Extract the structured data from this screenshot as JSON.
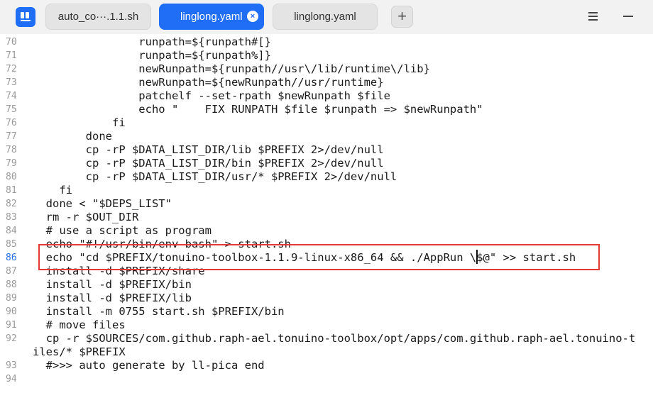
{
  "window": {
    "tabs": [
      {
        "label": "auto_co···.1.1.sh",
        "active": false
      },
      {
        "label": "linglong.yaml",
        "active": true
      },
      {
        "label": "linglong.yaml",
        "active": false
      }
    ],
    "add_tab_label": "+",
    "close_label": "×"
  },
  "editor": {
    "lines": [
      {
        "num": "70",
        "text": "                runpath=${runpath#[}"
      },
      {
        "num": "71",
        "text": "                runpath=${runpath%]}"
      },
      {
        "num": "72",
        "text": "                newRunpath=${runpath//usr\\/lib/runtime\\/lib}"
      },
      {
        "num": "73",
        "text": "                newRunpath=${newRunpath//usr/runtime}"
      },
      {
        "num": "74",
        "text": "                patchelf --set-rpath $newRunpath $file"
      },
      {
        "num": "75",
        "text": "                echo \"    FIX RUNPATH $file $runpath => $newRunpath\""
      },
      {
        "num": "76",
        "text": "            fi"
      },
      {
        "num": "77",
        "text": "        done"
      },
      {
        "num": "78",
        "text": "        cp -rP $DATA_LIST_DIR/lib $PREFIX 2>/dev/null"
      },
      {
        "num": "79",
        "text": "        cp -rP $DATA_LIST_DIR/bin $PREFIX 2>/dev/null"
      },
      {
        "num": "80",
        "text": "        cp -rP $DATA_LIST_DIR/usr/* $PREFIX 2>/dev/null"
      },
      {
        "num": "81",
        "text": "    fi"
      },
      {
        "num": "82",
        "text": "  done < \"$DEPS_LIST\""
      },
      {
        "num": "83",
        "text": "  rm -r $OUT_DIR"
      },
      {
        "num": "84",
        "text": "  # use a script as program"
      },
      {
        "num": "85",
        "text": "  echo \"#!/usr/bin/env bash\" > start.sh"
      },
      {
        "num": "86",
        "text": "  echo \"cd $PREFIX/tonuino-toolbox-1.1.9-linux-x86_64 && ./AppRun \\$@\" >> start.sh"
      },
      {
        "num": "87",
        "text": "  install -d $PREFIX/share"
      },
      {
        "num": "88",
        "text": "  install -d $PREFIX/bin"
      },
      {
        "num": "89",
        "text": "  install -d $PREFIX/lib"
      },
      {
        "num": "90",
        "text": "  install -m 0755 start.sh $PREFIX/bin"
      },
      {
        "num": "91",
        "text": "  # move files"
      },
      {
        "num": "92",
        "text": "  cp -r $SOURCES/com.github.raph-ael.tonuino-toolbox/opt/apps/com.github.raph-ael.tonuino-t"
      },
      {
        "num": "",
        "text": "iles/* $PREFIX"
      },
      {
        "num": "93",
        "text": "  #>>> auto generate by ll-pica end"
      },
      {
        "num": "94",
        "text": ""
      }
    ]
  },
  "colors": {
    "accent": "#1f6ef5",
    "highlight_box": "#e53935",
    "current_line_number": "#2b6fe0"
  }
}
